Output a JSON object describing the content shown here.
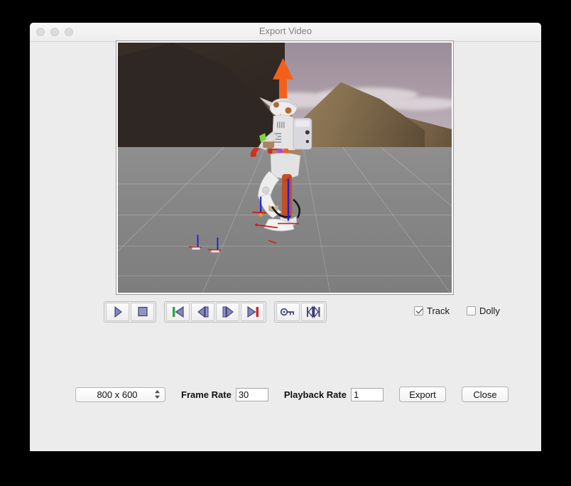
{
  "window": {
    "title": "Export Video",
    "traffic_lights": [
      "close-button",
      "minimize-button",
      "zoom-button"
    ]
  },
  "viewport": {
    "name": "3d-render-viewport",
    "scene_description": "Humanoid robot standing on a gray ground plane in front of a mountain landscape backdrop with an orange upward force arrow above its head",
    "colors": {
      "sky": "#a99aa5",
      "ground": "#868686",
      "dark_mountain": "#2f2723",
      "lit_mountain": "#85704f",
      "arrow": "#f4601a",
      "robot_body": "#e8e8e8",
      "robot_accent": "#c0502a"
    }
  },
  "toolbar": {
    "groups": [
      {
        "name": "playback-group",
        "buttons": [
          {
            "name": "play-button",
            "icon": "play-icon"
          },
          {
            "name": "stop-button",
            "icon": "stop-icon"
          }
        ]
      },
      {
        "name": "frame-navigation-group",
        "buttons": [
          {
            "name": "go-to-start-button",
            "icon": "skip-to-start-icon"
          },
          {
            "name": "step-back-button",
            "icon": "step-backward-icon"
          },
          {
            "name": "step-forward-button",
            "icon": "step-forward-icon"
          },
          {
            "name": "go-to-end-button",
            "icon": "skip-to-end-icon"
          }
        ]
      },
      {
        "name": "keyframe-group",
        "buttons": [
          {
            "name": "key-button",
            "icon": "key-icon"
          },
          {
            "name": "fit-range-button",
            "icon": "collapse-to-center-icon"
          }
        ]
      }
    ]
  },
  "options": {
    "track": {
      "label": "Track",
      "checked": true
    },
    "dolly": {
      "label": "Dolly",
      "checked": false
    }
  },
  "export_bar": {
    "resolution": {
      "value": "800 x 600",
      "options": [
        "800 x 600"
      ]
    },
    "frame_rate": {
      "label": "Frame Rate",
      "value": "30"
    },
    "playback_rate": {
      "label": "Playback Rate",
      "value": "1"
    },
    "export_button": "Export",
    "close_button": "Close"
  }
}
